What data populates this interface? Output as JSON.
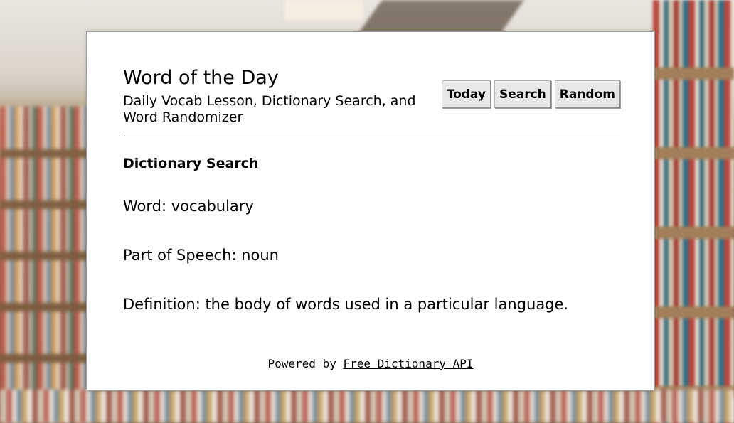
{
  "header": {
    "title": "Word of the Day",
    "subtitle": "Daily Vocab Lesson, Dictionary Search, and Word Randomizer"
  },
  "nav": {
    "today_label": "Today",
    "search_label": "Search",
    "random_label": "Random"
  },
  "main": {
    "section_title": "Dictionary Search",
    "word_label": "Word:",
    "word_value": "vocabulary",
    "pos_label": "Part of Speech:",
    "pos_value": "noun",
    "definition_label": "Definition:",
    "definition_value": "the body of words used in a particular language."
  },
  "footer": {
    "prefix": "Powered by",
    "link_text": "Free Dictionary API"
  }
}
